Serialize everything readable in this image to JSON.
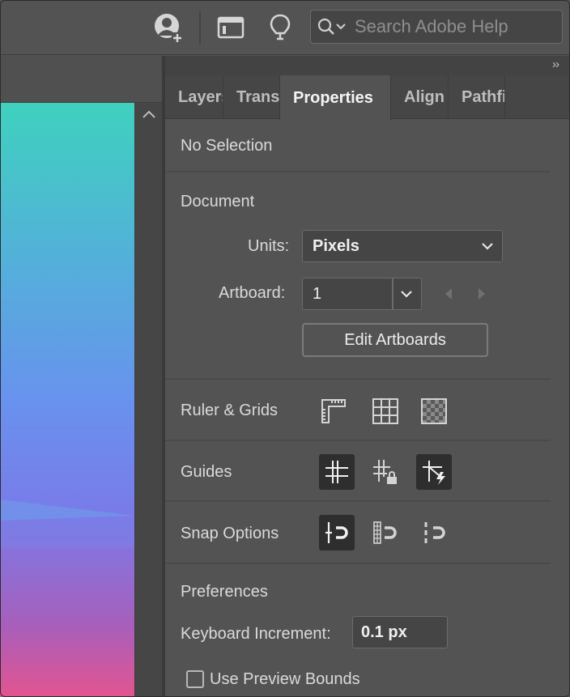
{
  "topbar": {
    "search_placeholder": "Search Adobe Help",
    "icons": [
      "user-add-icon",
      "workspace-icon",
      "lightbulb-icon",
      "search-icon"
    ]
  },
  "panel": {
    "tabs": [
      {
        "label": "Layers",
        "active": false
      },
      {
        "label": "Transform",
        "active": false
      },
      {
        "label": "Properties",
        "active": true
      },
      {
        "label": "Align",
        "active": false
      },
      {
        "label": "Pathfinder",
        "active": false
      }
    ],
    "selection": "No Selection",
    "document": {
      "heading": "Document",
      "units_label": "Units:",
      "units_value": "Pixels",
      "artboard_label": "Artboard:",
      "artboard_value": "1",
      "edit_artboards": "Edit Artboards"
    },
    "ruler_grids": "Ruler & Grids",
    "guides": "Guides",
    "snap_options": "Snap Options",
    "preferences": {
      "heading": "Preferences",
      "keyboard_increment_label": "Keyboard Increment:",
      "keyboard_increment_value": "0.1 px",
      "use_preview_bounds": "Use Preview Bounds"
    }
  },
  "colors": {
    "panel_bg": "#535353",
    "canvas_top": "#3fd1bf",
    "canvas_bottom": "#e35490"
  }
}
